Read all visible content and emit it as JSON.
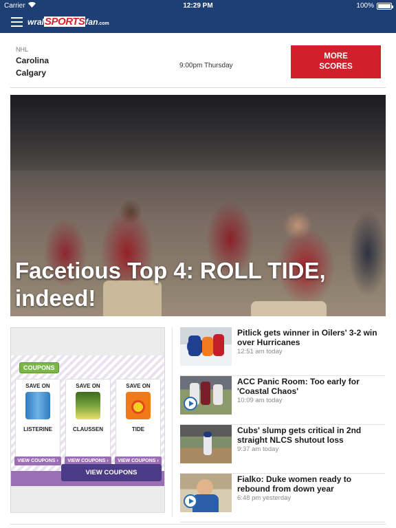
{
  "status_bar": {
    "carrier": "Carrier",
    "time": "12:29 PM",
    "battery": "100%",
    "battery_level": 1.0
  },
  "header": {
    "logo": {
      "part1": "wral",
      "part2": "SPORTS",
      "part3": "fan",
      "part4": ".com"
    }
  },
  "scores": {
    "league": "NHL",
    "team1": "Carolina",
    "team2": "Calgary",
    "game_time": "9:00pm Thursday",
    "more_scores_label": "MORE SCORES"
  },
  "hero": {
    "headline": "Facetious Top 4: ROLL TIDE, indeed!"
  },
  "ad": {
    "badge": "COUPONS",
    "coupons": [
      {
        "save": "SAVE ON",
        "product": "LISTERINE",
        "button": "VIEW COUPONS ›",
        "color": "#3a8fd0"
      },
      {
        "save": "SAVE ON",
        "product": "CLAUSSEN",
        "button": "VIEW COUPONS ›",
        "color": "#5a7f2e"
      },
      {
        "save": "SAVE ON",
        "product": "TIDE",
        "button": "VIEW COUPONS ›",
        "color": "#f07a1a"
      }
    ],
    "cta": "VIEW COUPONS"
  },
  "news": [
    {
      "title": "Pitlick gets winner in Oilers' 3-2 win over Hurricanes",
      "time": "12:51 am today",
      "video": false
    },
    {
      "title": "ACC Panic Room: Too early for 'Coastal Chaos'",
      "time": "10:09 am today",
      "video": true
    },
    {
      "title": "Cubs' slump gets critical in 2nd straight NLCS shutout loss",
      "time": "9:37 am today",
      "video": false
    },
    {
      "title": "Fialko: Duke women ready to rebound from down year",
      "time": "6:48 pm yesterday",
      "video": true
    }
  ]
}
